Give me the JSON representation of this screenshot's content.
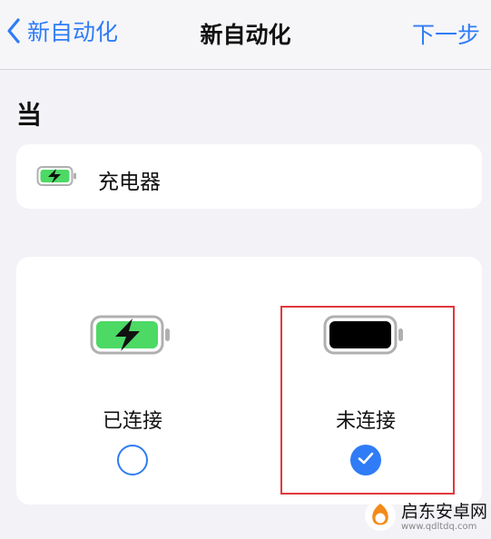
{
  "nav": {
    "back_label": "新自动化",
    "title": "新自动化",
    "next_label": "下一步"
  },
  "section": {
    "title": "当"
  },
  "trigger": {
    "label": "充电器"
  },
  "options": [
    {
      "label": "已连接",
      "selected": false,
      "battery": "charging-battery-icon"
    },
    {
      "label": "未连接",
      "selected": true,
      "battery": "battery-icon"
    }
  ],
  "watermark": {
    "title": "启东安卓网",
    "url": "www.qdltdq.com"
  },
  "colors": {
    "accent": "#2f7cf6",
    "charge_green": "#4cd964",
    "highlight_red": "#e0383e"
  }
}
